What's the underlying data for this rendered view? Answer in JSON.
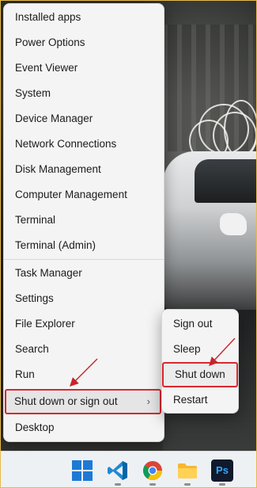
{
  "menu": {
    "items": [
      {
        "label": "Installed apps"
      },
      {
        "label": "Power Options"
      },
      {
        "label": "Event Viewer"
      },
      {
        "label": "System"
      },
      {
        "label": "Device Manager"
      },
      {
        "label": "Network Connections"
      },
      {
        "label": "Disk Management"
      },
      {
        "label": "Computer Management"
      },
      {
        "label": "Terminal"
      },
      {
        "label": "Terminal (Admin)"
      },
      {
        "label": "Task Manager"
      },
      {
        "label": "Settings"
      },
      {
        "label": "File Explorer"
      },
      {
        "label": "Search"
      },
      {
        "label": "Run"
      },
      {
        "label": "Shut down or sign out"
      },
      {
        "label": "Desktop"
      }
    ],
    "submenu_chevron": "›"
  },
  "submenu": {
    "items": [
      {
        "label": "Sign out"
      },
      {
        "label": "Sleep"
      },
      {
        "label": "Shut down"
      },
      {
        "label": "Restart"
      }
    ]
  },
  "taskbar": {
    "ps_label": "Ps",
    "icons": [
      "windows-start-icon",
      "vscode-icon",
      "chrome-icon",
      "file-explorer-icon",
      "photoshop-icon"
    ]
  },
  "colors": {
    "highlight_border": "#d9282f",
    "annotation_arrow": "#c8232b",
    "frame_border": "#e7b94a"
  }
}
